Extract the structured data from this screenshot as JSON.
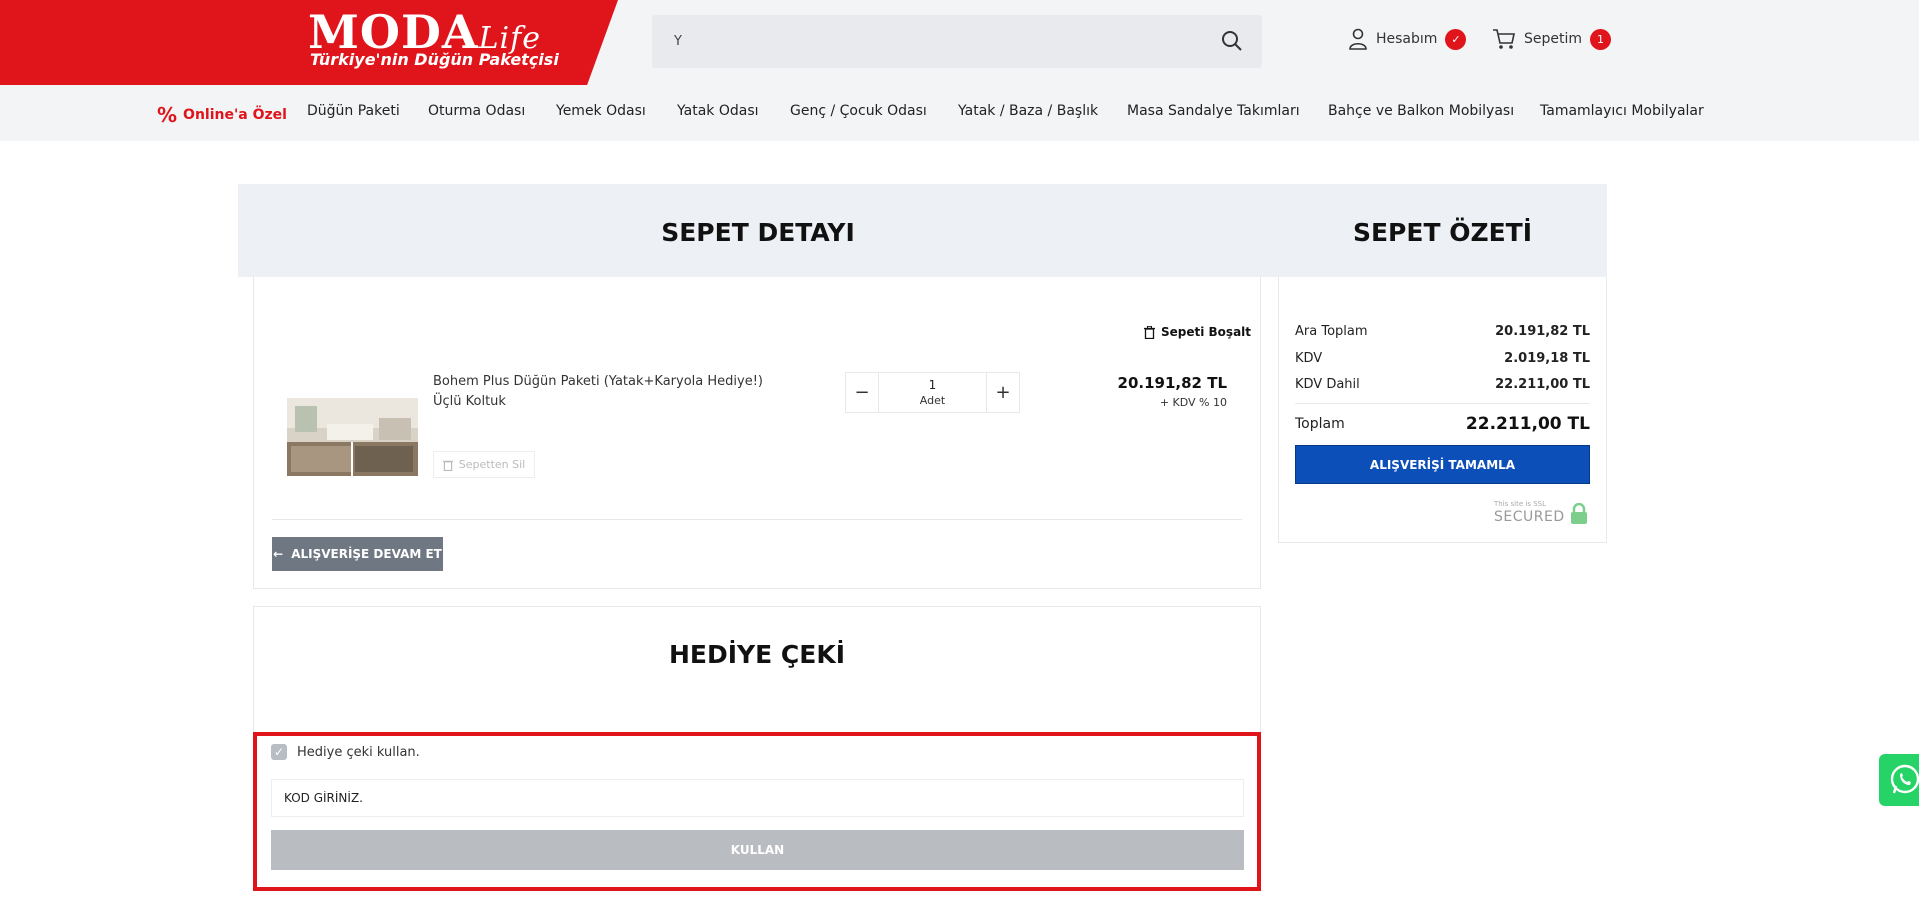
{
  "header": {
    "logo_main": "MODA",
    "logo_sub": "Life",
    "logo_tagline": "Türkiye'nin Düğün Paketçisi",
    "search_value": "Y",
    "account_label": "Hesabım",
    "cart_label": "Sepetim",
    "cart_count": "1"
  },
  "nav": {
    "items": [
      "Online'a Özel",
      "Düğün Paketi",
      "Oturma Odası",
      "Yemek Odası",
      "Yatak Odası",
      "Genç / Çocuk Odası",
      "Yatak / Baza / Başlık",
      "Masa Sandalye Takımları",
      "Bahçe ve Balkon Mobilyası",
      "Tamamlayıcı Mobilyalar"
    ]
  },
  "cart": {
    "title": "SEPET DETAYI",
    "empty_label": "Sepeti Boşalt",
    "product_name": "Bohem Plus Düğün Paketi (Yatak+Karyola Hediye!) Üçlü Koltuk",
    "remove_label": "Sepetten Sil",
    "quantity": "1",
    "quantity_unit": "Adet",
    "price": "20.191,82 TL",
    "tax_note": "+ KDV % 10",
    "continue_label": "ALIŞVERİŞE DEVAM ET"
  },
  "summary": {
    "title": "SEPET ÖZETİ",
    "subtotal_label": "Ara Toplam",
    "subtotal_value": "20.191,82 TL",
    "tax_label": "KDV",
    "tax_value": "2.019,18 TL",
    "tax_incl_label": "KDV Dahil",
    "tax_incl_value": "22.211,00 TL",
    "total_label": "Toplam",
    "total_value": "22.211,00 TL",
    "checkout_label": "ALIŞVERİŞİ TAMAMLA",
    "ssl_small": "This site is SSL",
    "ssl_big": "SECURED"
  },
  "gift": {
    "title": "HEDİYE ÇEKİ",
    "checkbox_label": "Hediye çeki kullan.",
    "code_placeholder": "KOD GİRİNİZ.",
    "use_label": "KULLAN"
  },
  "colors": {
    "brand_red": "#e0141b",
    "checkout_blue": "#0d4fb8",
    "whatsapp_green": "#25d366"
  }
}
